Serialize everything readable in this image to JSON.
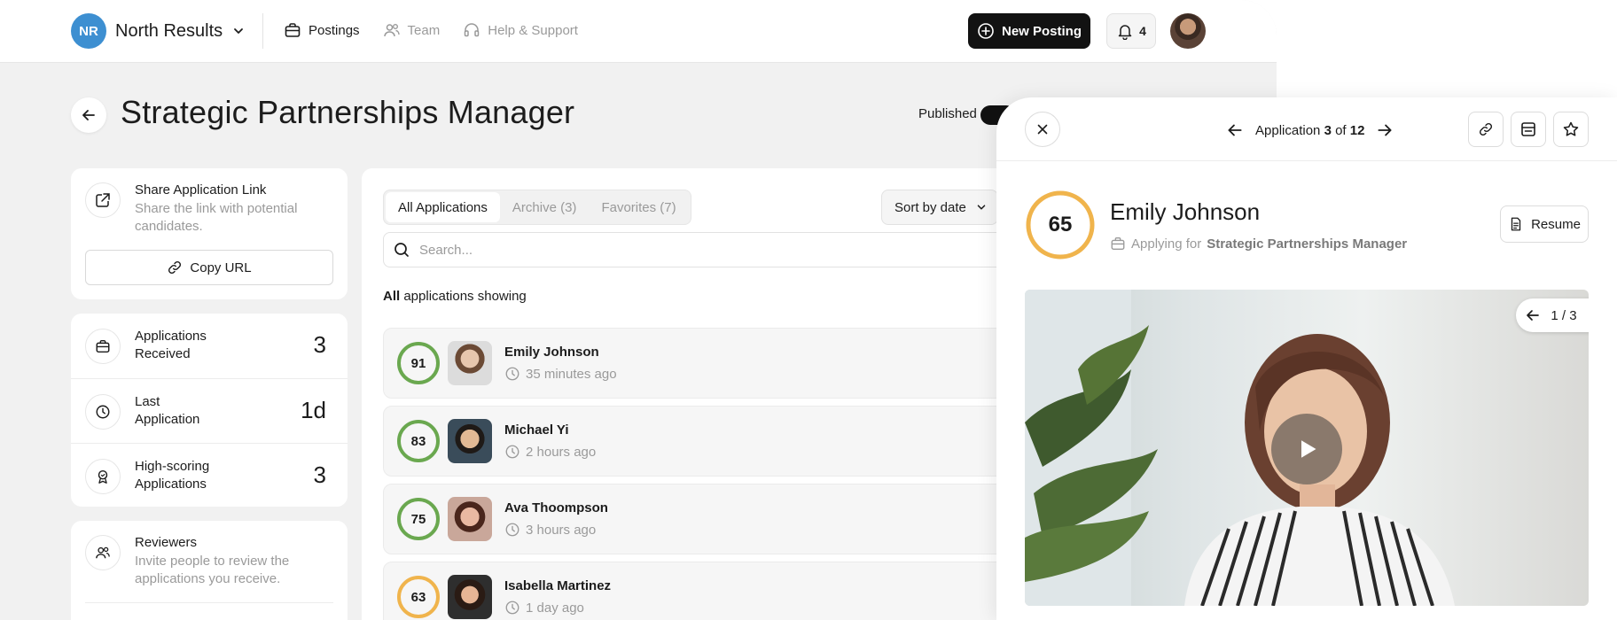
{
  "org": {
    "initials": "NR",
    "name": "North Results"
  },
  "nav": [
    {
      "label": "Postings",
      "icon": "briefcase-icon"
    },
    {
      "label": "Team",
      "icon": "team-icon"
    },
    {
      "label": "Help & Support",
      "icon": "headset-icon"
    }
  ],
  "header": {
    "new_posting": "New Posting",
    "notifications": "4"
  },
  "page": {
    "title": "Strategic Partnerships Manager",
    "published_label": "Published"
  },
  "share": {
    "title": "Share Application Link",
    "subtitle": "Share the link with potential candidates.",
    "copy_label": "Copy URL"
  },
  "stats": [
    {
      "label": "Applications Received",
      "value": "3",
      "icon": "briefcase-icon"
    },
    {
      "label": "Last Application",
      "value": "1d",
      "icon": "clock-icon"
    },
    {
      "label": "High-scoring Applications",
      "value": "3",
      "icon": "award-icon"
    }
  ],
  "reviewers": {
    "title": "Reviewers",
    "subtitle": "Invite people to review the applications you receive."
  },
  "tabs": [
    {
      "label": "All Applications",
      "active": true
    },
    {
      "label": "Archive (3)",
      "active": false
    },
    {
      "label": "Favorites (7)",
      "active": false
    }
  ],
  "sort": {
    "label": "Sort by date"
  },
  "search": {
    "placeholder": "Search..."
  },
  "showing": {
    "bold": "All",
    "rest": " applications showing"
  },
  "applications": [
    {
      "score": 91,
      "name": "Emily Johnson",
      "time": "35 minutes ago",
      "ring_color": "#6aa84f"
    },
    {
      "score": 83,
      "name": "Michael Yi",
      "time": "2 hours ago",
      "ring_color": "#6aa84f"
    },
    {
      "score": 75,
      "name": "Ava Thoompson",
      "time": "3 hours ago",
      "ring_color": "#6aa84f"
    },
    {
      "score": 63,
      "name": "Isabella Martinez",
      "time": "1 day ago",
      "ring_color": "#f0b44c"
    }
  ],
  "panel": {
    "app_prefix": "Application",
    "app_index": "3",
    "app_of": "of",
    "app_total": "12",
    "score": 65,
    "ring_color": "#f0b44c",
    "name": "Emily Johnson",
    "applying_prefix": "Applying for",
    "applying_role": "Strategic Partnerships Manager",
    "resume_label": "Resume",
    "media_counter": "1 / 3"
  }
}
